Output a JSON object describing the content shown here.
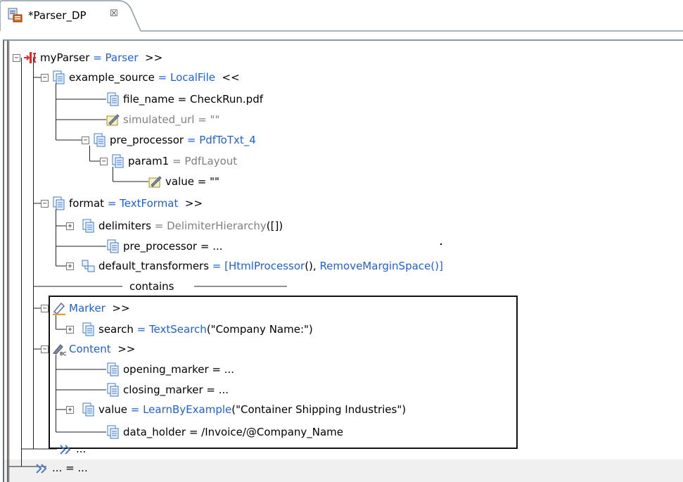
{
  "tab": {
    "title": "*Parser_DP",
    "close_glyph": "☒",
    "icon": "data-processor-file-icon"
  },
  "colors": {
    "type_blue": "#1f5fd8",
    "gray": "#7f7f7f",
    "strip": "#f0f0f0"
  },
  "tree": {
    "root": {
      "name": "myParser",
      "eq": " = ",
      "type": "Parser",
      "arrow": ">>"
    },
    "example_source": {
      "name": "example_source",
      "eq": " = ",
      "type": "LocalFile",
      "arrow": "<<"
    },
    "file_name": {
      "name": "file_name",
      "eq": " = ",
      "value": "CheckRun.pdf"
    },
    "simulated_url": {
      "name": "simulated_url",
      "eq": " = ",
      "value": "\"\""
    },
    "pre_processor": {
      "name": "pre_processor",
      "eq": " = ",
      "type": "PdfToTxt_4"
    },
    "param1": {
      "name": "param1",
      "eq": " = ",
      "type": "PdfLayout"
    },
    "param_value": {
      "name": "value",
      "eq": " = ",
      "value": "\"\""
    },
    "format": {
      "name": "format",
      "eq": " = ",
      "type": "TextFormat",
      "arrow": ">>"
    },
    "delimiters": {
      "name": "delimiters",
      "eq": " = ",
      "type": "DelimiterHierarchy",
      "rest": "([])"
    },
    "format_pre_processor": {
      "name": "pre_processor",
      "eq": " = ",
      "value": "..."
    },
    "default_transformers": {
      "name": "default_transformers",
      "eq": " = ",
      "open": "[",
      "t1": "HtmlProcessor",
      "mid": "(), ",
      "t2": "RemoveMarginSpace",
      "close": "()]"
    },
    "contains": "contains",
    "marker": {
      "type": "Marker",
      "arrow": ">>"
    },
    "search": {
      "name": "search",
      "eq": " = ",
      "type": "TextSearch",
      "rest": "(\"Company Name:\")"
    },
    "content": {
      "type": "Content",
      "arrow": ">>"
    },
    "opening_marker": {
      "name": "opening_marker",
      "eq": " = ",
      "value": "..."
    },
    "closing_marker": {
      "name": "closing_marker",
      "eq": " = ",
      "value": "..."
    },
    "content_value": {
      "name": "value",
      "eq": " = ",
      "type": "LearnByExample",
      "rest": "(\"Container Shipping Industries\")"
    },
    "data_holder": {
      "name": "data_holder",
      "eq": " = ",
      "value": "/Invoice/@Company_Name"
    },
    "more_inner": "...",
    "more_outer": "... = ..."
  }
}
